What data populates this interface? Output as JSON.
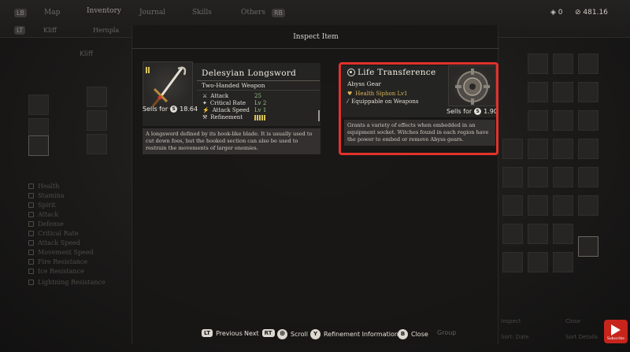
{
  "nav": {
    "lb": "LB",
    "rb": "RB",
    "lt": "LT",
    "rt": "RT",
    "tabs": [
      "Map",
      "Inventory",
      "Journal",
      "Skills",
      "Others"
    ],
    "subtabs": [
      "Kliff",
      "Hernpla"
    ],
    "character": "Kliff",
    "currency_a": "0",
    "currency_b": "481.16"
  },
  "stats": [
    "Health",
    "Stamina",
    "Spirit",
    "Attack",
    "Defense",
    "Critical Rate",
    "Attack Speed",
    "Movement Speed",
    "Ice Resistance",
    "Fire Resistance",
    "Lightning Resistance"
  ],
  "modal": {
    "title": "Inspect Item",
    "left_item": {
      "name": "Delesyian Longsword",
      "type": "Two-Handed Weapon",
      "stats": [
        {
          "label": "Attack",
          "value": "25",
          "icon": "attack-icon"
        },
        {
          "label": "Critical Rate",
          "value": "Lv 2",
          "icon": "critical-icon"
        },
        {
          "label": "Attack Speed",
          "value": "Lv 1",
          "icon": "speed-icon"
        },
        {
          "label": "Refinement",
          "value": "",
          "icon": "refinement-icon"
        }
      ],
      "sells_label": "Sells for",
      "sells_value": "18.64",
      "description": "A longsword defined by its hook-like blade. It is usually used to cut down foes, but the hooked section can also be used to restrain the movements of larger enemies."
    },
    "right_item": {
      "name": "Life Transference",
      "type": "Abyss Gear",
      "effect": "Health Siphon Lv1",
      "equip_note": "Equippable on Weapons",
      "sells_label": "Sells for",
      "sells_value": "1.90",
      "description": "Grants a variety of effects when embedded in an equipment socket. Witches found in each region have the power to embed or remove Abyss gears."
    }
  },
  "hints": {
    "lt": "LT",
    "previous": "Previous",
    "next": "Next",
    "rt": "RT",
    "scroll": "Scroll",
    "y": "Y",
    "refinement": "Refinement Information",
    "b": "B",
    "close": "Close"
  },
  "bg_hints": {
    "group": "Group",
    "inspect": "Inspect",
    "close2": "Close",
    "sort": "Sort: Date",
    "details": "Sort Details"
  },
  "badge": {
    "subscribe": "Subscribe"
  },
  "colors": {
    "highlight": "#e2322c",
    "stat_value": "#9fc98d",
    "abyss_effect": "#d9b45a"
  }
}
